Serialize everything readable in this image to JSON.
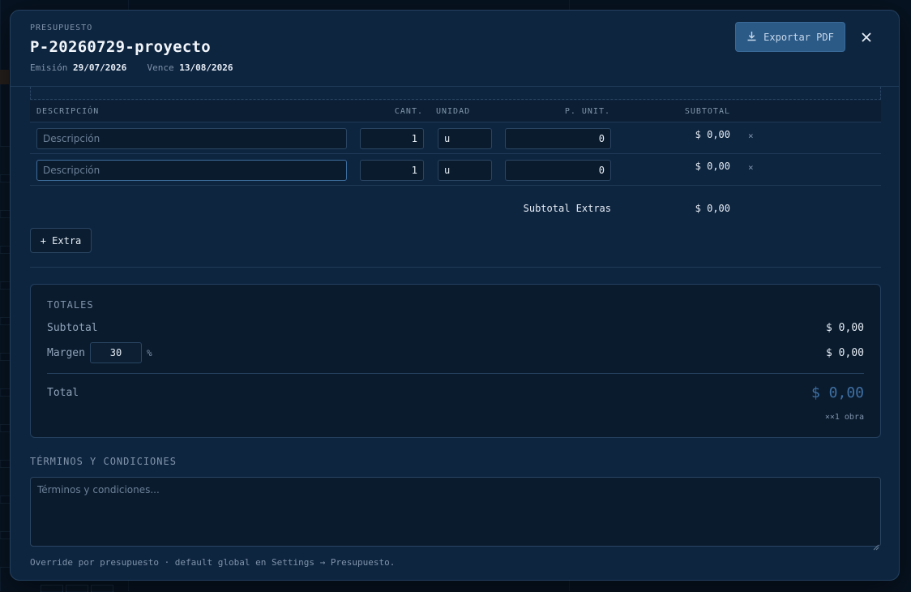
{
  "header": {
    "eyebrow": "PRESUPUESTO",
    "title": "P-20260729-proyecto",
    "emision_label": "Emisión",
    "emision_value": "29/07/2026",
    "vence_label": "Vence",
    "vence_value": "13/08/2026",
    "export_label": "Exportar PDF",
    "export_icon": "download-icon",
    "close_icon": "close-icon"
  },
  "extras_table": {
    "columns": {
      "descripcion": "DESCRIPCIÓN",
      "cant": "CANT.",
      "unidad": "UNIDAD",
      "p_unit": "P. UNIT.",
      "subtotal": "SUBTOTAL"
    },
    "rows": [
      {
        "descripcion": "",
        "placeholder": "Descripción",
        "cant": "1",
        "unidad": "u",
        "p_unit": "0",
        "subtotal": "$ 0,00",
        "remove": "×"
      },
      {
        "descripcion": "",
        "placeholder": "Descripción",
        "cant": "1",
        "unidad": "u",
        "p_unit": "0",
        "subtotal": "$ 0,00",
        "remove": "×"
      }
    ],
    "subtotal_label": "Subtotal Extras",
    "subtotal_value": "$ 0,00",
    "add_extra_label": "+ Extra"
  },
  "totales": {
    "heading": "TOTALES",
    "subtotal_label": "Subtotal",
    "subtotal_value": "$ 0,00",
    "margen_label": "Margen",
    "margen_value": "30",
    "margen_unit": "%",
    "margen_amount": "$ 0,00",
    "total_label": "Total",
    "total_value": "$ 0,00",
    "total_note": "××1 obra"
  },
  "terminos": {
    "heading": "TÉRMINOS Y CONDICIONES",
    "placeholder": "Términos y condiciones...",
    "value": "",
    "note": "Override por presupuesto · default global en Settings → Presupuesto."
  },
  "colors": {
    "modal_bg": "#0e2540",
    "accent_button": "#2c5a87",
    "total_accent": "#3f70a3"
  }
}
